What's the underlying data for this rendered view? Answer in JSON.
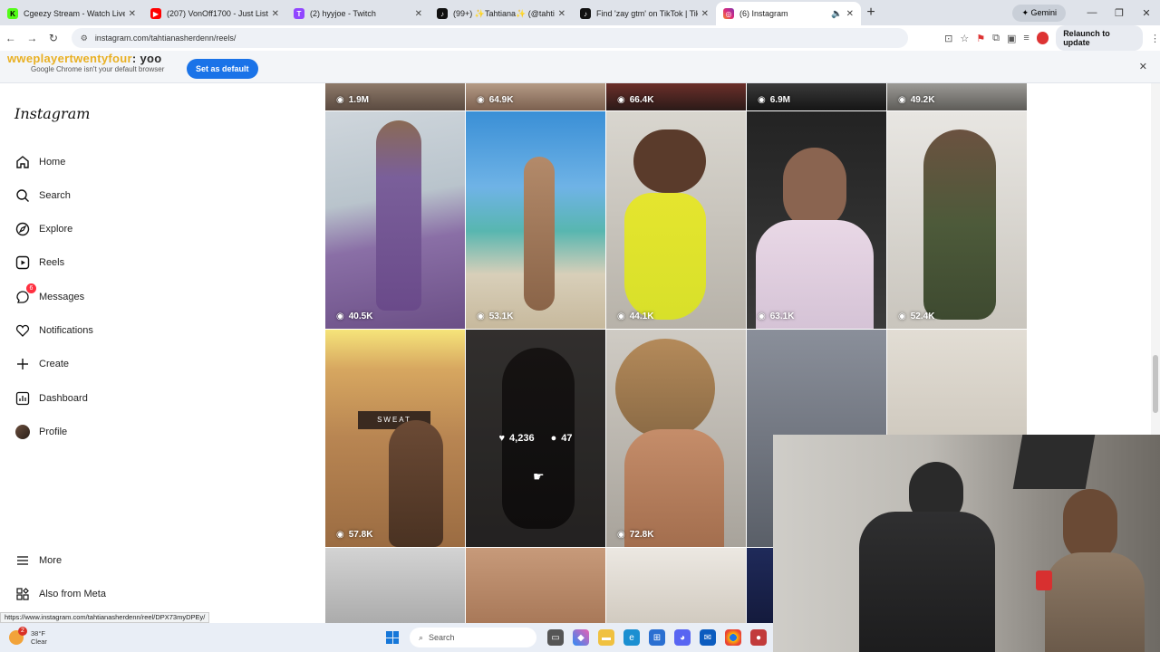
{
  "browser": {
    "tabs": [
      {
        "label": "Cgeezy Stream - Watch Live on",
        "icon": "kick-icon",
        "color": "#53fc18"
      },
      {
        "label": "(207) VonOff1700 - Just Listen",
        "icon": "youtube-icon",
        "color": "#ff0000"
      },
      {
        "label": "(2) hyyjoe - Twitch",
        "icon": "twitch-icon",
        "color": "#9146ff"
      },
      {
        "label": "(99+) ✨Tahtiana✨ (@tahtian",
        "icon": "tiktok-icon",
        "color": "#111111"
      },
      {
        "label": "Find 'zay gtm' on TikTok | TikTo",
        "icon": "tiktok-icon",
        "color": "#111111"
      },
      {
        "label": "(6) Instagram",
        "icon": "instagram-icon",
        "color": "#d6249f",
        "active": true
      }
    ],
    "new_tab": "+",
    "gemini_label": "Gemini",
    "url": "instagram.com/tahtianasherdenn/reels/",
    "relaunch_label": "Relaunch to update",
    "infobar": {
      "overlay_name": "wweplayertwentyfour",
      "overlay_msg": ": yoo",
      "message": "Google Chrome isn't your default browser",
      "button": "Set as default",
      "close": "✕"
    },
    "status_url": "https://www.instagram.com/tahtianasherdenn/reel/DPX73myDPEy/"
  },
  "instagram": {
    "logo": "Instagram",
    "nav": [
      {
        "label": "Home",
        "icon": "home-icon"
      },
      {
        "label": "Search",
        "icon": "search-icon"
      },
      {
        "label": "Explore",
        "icon": "explore-icon"
      },
      {
        "label": "Reels",
        "icon": "reels-icon"
      },
      {
        "label": "Messages",
        "icon": "messages-icon",
        "badge": "6"
      },
      {
        "label": "Notifications",
        "icon": "heart-icon"
      },
      {
        "label": "Create",
        "icon": "plus-icon"
      },
      {
        "label": "Dashboard",
        "icon": "dashboard-icon"
      },
      {
        "label": "Profile",
        "icon": "profile-avatar"
      }
    ],
    "more": "More",
    "also_from_meta": "Also from Meta",
    "top_row_views": [
      "1.9M",
      "64.9K",
      "66.4K",
      "6.9M",
      "49.2K"
    ],
    "row1_views": [
      "40.5K",
      "53.1K",
      "44.1K",
      "63.1K",
      "52.4K"
    ],
    "row2_views": [
      "57.8K",
      "",
      "72.8K",
      "",
      ""
    ],
    "hover": {
      "likes": "4,236",
      "comments": "47"
    }
  },
  "taskbar": {
    "weather_temp": "38°F",
    "weather_desc": "Clear",
    "notification_count": "2",
    "search_placeholder": "Search"
  }
}
